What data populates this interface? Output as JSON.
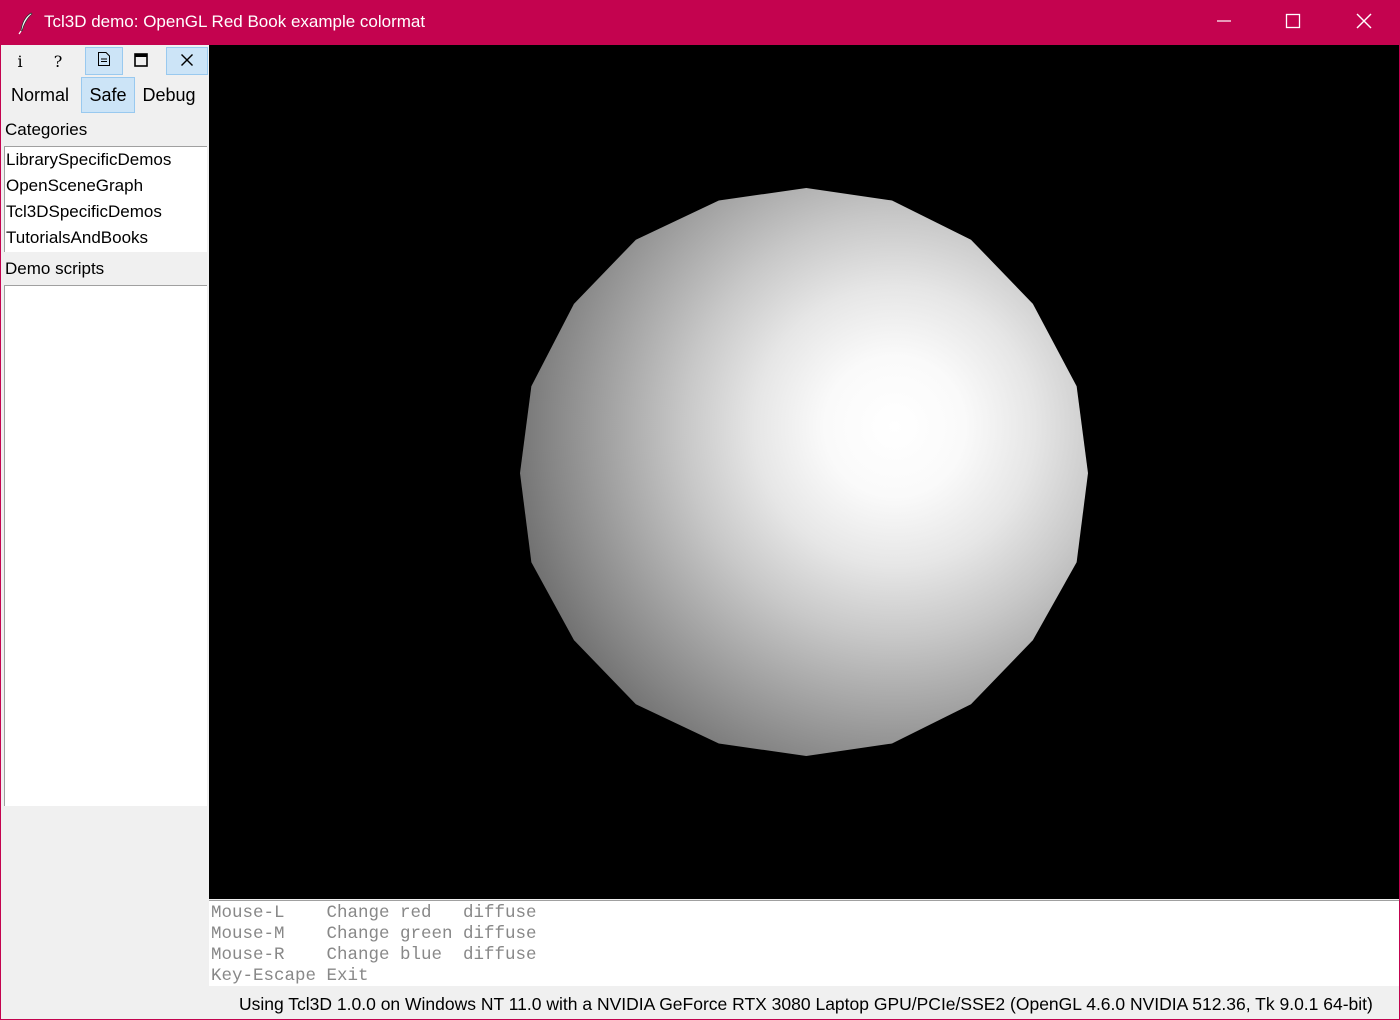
{
  "window": {
    "title": "Tcl3D demo: OpenGL Red Book example colormat",
    "accent_color": "#c4034f",
    "app_icon": "feather-icon",
    "controls": [
      "minimize-icon",
      "maximize-icon",
      "close-icon"
    ]
  },
  "toolbar": {
    "buttons": [
      {
        "label": "i",
        "icon": "info-icon"
      },
      {
        "label": "?",
        "icon": "help-icon"
      },
      {
        "label": "",
        "icon": "document-icon",
        "active": true
      },
      {
        "label": "",
        "icon": "fullscreen-icon"
      },
      {
        "label": "",
        "icon": "close-icon",
        "active": true
      }
    ]
  },
  "modes": {
    "items": [
      "Normal",
      "Safe",
      "Debug"
    ],
    "selected": "Safe"
  },
  "categories": {
    "label": "Categories",
    "items": [
      "LibrarySpecificDemos",
      "OpenSceneGraph",
      "Tcl3DSpecificDemos",
      "TutorialsAndBooks"
    ]
  },
  "scripts": {
    "label": "Demo scripts",
    "items": []
  },
  "info": {
    "lines": [
      "Mouse-L    Change red   diffuse",
      "Mouse-M    Change green diffuse",
      "Mouse-R    Change blue  diffuse",
      "Key-Escape Exit"
    ]
  },
  "status": {
    "text": "Using Tcl3D 1.0.0 on Windows NT 11.0 with a NVIDIA GeForce RTX 3080 Laptop GPU/PCIe/SSE2 (OpenGL 4.6.0 NVIDIA 512.36, Tk 9.0.1 64-bit)"
  }
}
